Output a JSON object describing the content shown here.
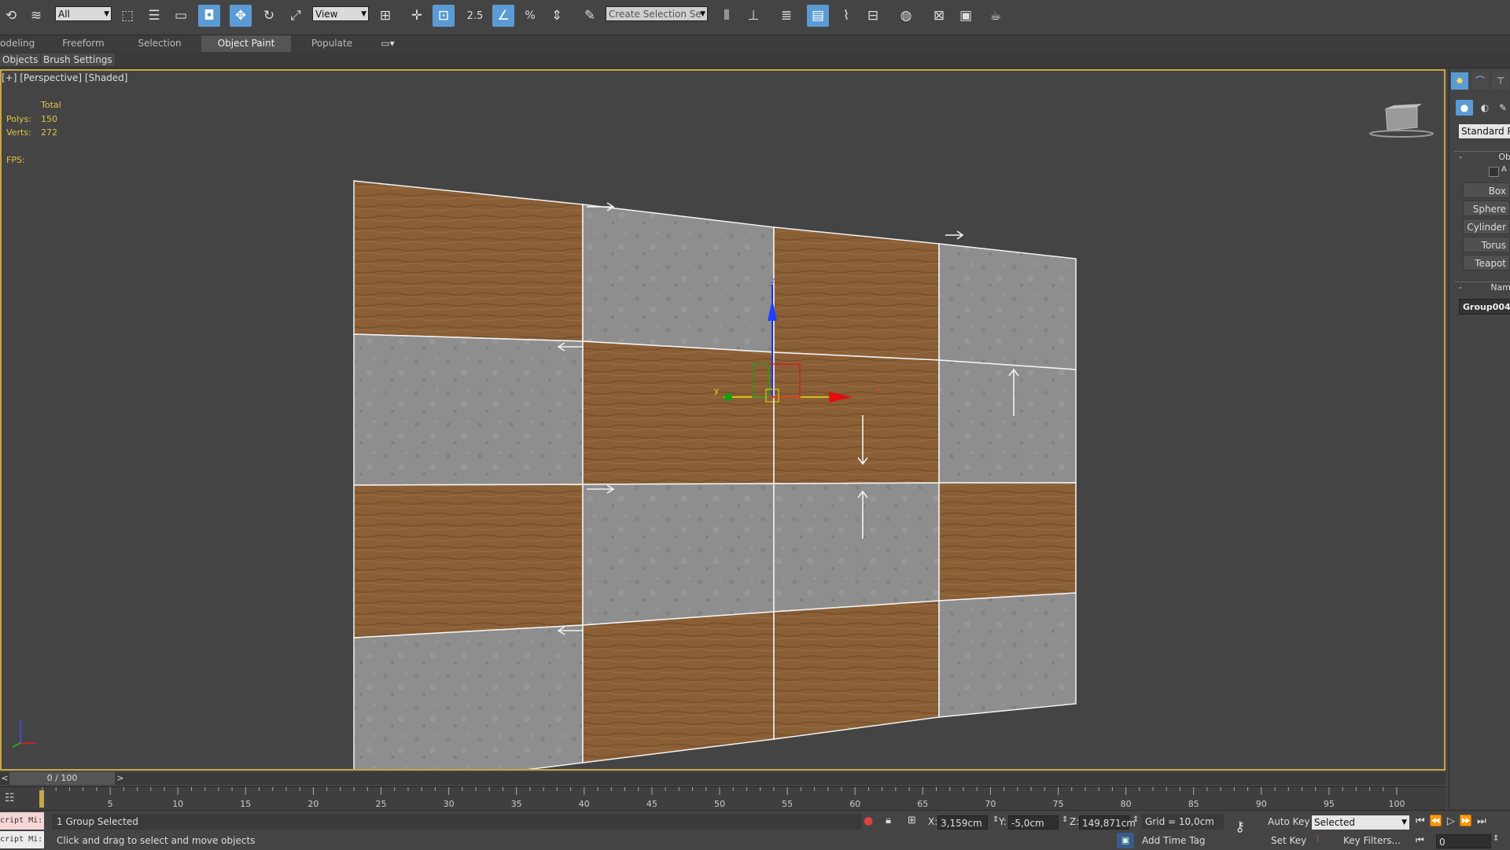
{
  "toolbar": {
    "selection_filter": "All",
    "reference_coord": "View",
    "snap_label": "2.5",
    "selection_set_placeholder": "Create Selection Se",
    "icons": [
      "undo-icon",
      "redo-icon",
      "select-object-icon",
      "select-by-name-icon",
      "rect-region-icon",
      "window-crossing-icon",
      "move-icon",
      "rotate-icon",
      "scale-icon",
      "pivot-icon",
      "manipulate-icon",
      "keyboard-shortcut-icon",
      "snap-icon",
      "angle-snap-icon",
      "percent-snap-icon",
      "spinner-snap-icon",
      "edit-named-sets-icon",
      "mirror-icon",
      "align-icon",
      "layer-explorer-icon",
      "scene-explorer-icon",
      "curve-editor-icon",
      "schematic-view-icon",
      "material-editor-icon",
      "render-setup-icon",
      "rendered-frame-icon",
      "render-icon"
    ]
  },
  "ribbon": {
    "tabs": [
      "odeling",
      "Freeform",
      "Selection",
      "Object Paint",
      "Populate"
    ],
    "active_tab": "Object Paint",
    "sub_tabs": [
      "Objects",
      "Brush Settings"
    ]
  },
  "viewport": {
    "label": "[+] [Perspective] [Shaded]",
    "stats_header": "Total",
    "polys_label": "Polys:",
    "polys_value": "150",
    "verts_label": "Verts:",
    "verts_value": "272",
    "fps_label": "FPS:",
    "gizmo_x": "x",
    "gizmo_y": "y",
    "gizmo_z": "z",
    "tiles": [
      "wood",
      "concrete",
      "wood",
      "concrete",
      "concrete",
      "wood",
      "wood",
      "concrete",
      "wood",
      "concrete",
      "concrete",
      "wood",
      "concrete",
      "wood",
      "wood",
      "concrete"
    ]
  },
  "command_panel": {
    "category": "Standard Pri",
    "rollout_object_type": "Ob",
    "autogrid": "A",
    "buttons": [
      "Box",
      "Sphere",
      "Cylinder",
      "Torus",
      "Teapot"
    ],
    "rollout_name": "Nam",
    "name_value": "Group004"
  },
  "timeline": {
    "time_slider": "0 / 100",
    "prev": "<",
    "next": ">",
    "ticks": [
      "5",
      "10",
      "15",
      "20",
      "25",
      "30",
      "35",
      "40",
      "45",
      "50",
      "55",
      "60",
      "65",
      "70",
      "75",
      "80",
      "85",
      "90",
      "95",
      "100"
    ]
  },
  "status": {
    "maxscript": "cript Mi:",
    "selection_info": "1 Group Selected",
    "prompt": "Click and drag to select and move objects",
    "x_label": "X:",
    "x_value": "3,159cm",
    "y_label": "Y:",
    "y_value": "-5,0cm",
    "z_label": "Z:",
    "z_value": "149,871cm",
    "grid": "Grid = 10,0cm",
    "add_time_tag": "Add Time Tag",
    "auto_key": "Auto Key",
    "set_key": "Set Key",
    "key_mode": "Selected",
    "key_filters": "Key Filters...",
    "frame": "0"
  },
  "colors": {
    "wood": "#8a5f36",
    "concrete": "#8e8e8e",
    "viewport_border": "#c8a544",
    "stats_text": "#e2c541",
    "active_button": "#5b9bd5"
  }
}
